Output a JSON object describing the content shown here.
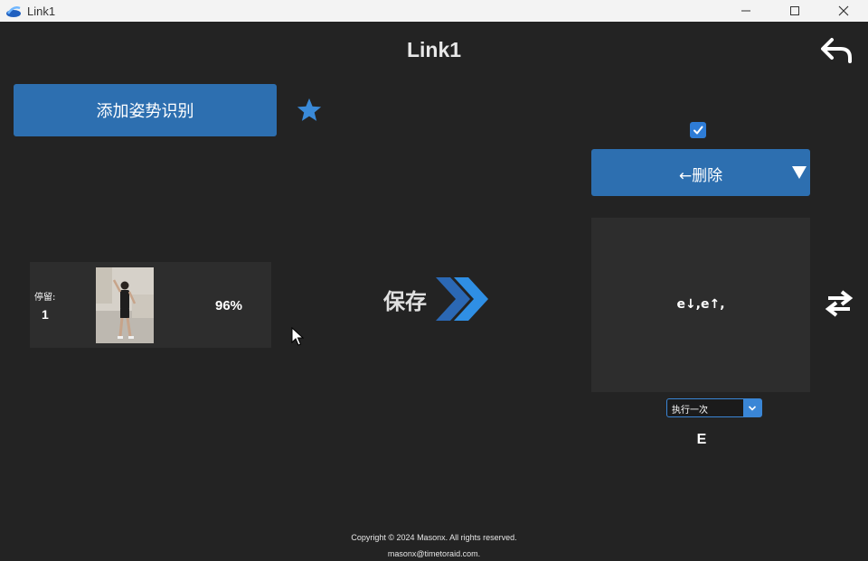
{
  "window": {
    "title": "Link1",
    "minimize": "—",
    "maximize": "☐",
    "close": "✕"
  },
  "header": {
    "title": "Link1",
    "back_icon": "undo-arrow-icon"
  },
  "left": {
    "add_button_label": "添加姿势识别",
    "favorite_icon": "star-icon",
    "pose_card": {
      "stay_label": "停留:",
      "stay_value": "1",
      "confidence": "96%"
    }
  },
  "center": {
    "save_label": "保存",
    "save_icon": "double-chevron-right-icon"
  },
  "right": {
    "enabled_checked": true,
    "action_dropdown_label": "←删除",
    "action_display": "e↓,e↑,",
    "swap_icon": "swap-arrows-icon",
    "exec_mode_selected": "执行一次",
    "key_label": "E"
  },
  "footer": {
    "copyright": "Copyright © 2024 Masonx. All rights reserved.",
    "email": "masonx@timetoraid.com."
  },
  "colors": {
    "background": "#232323",
    "accent": "#2d6fb0",
    "panel": "#2d2d2d",
    "checkbox": "#2e7cd6"
  }
}
